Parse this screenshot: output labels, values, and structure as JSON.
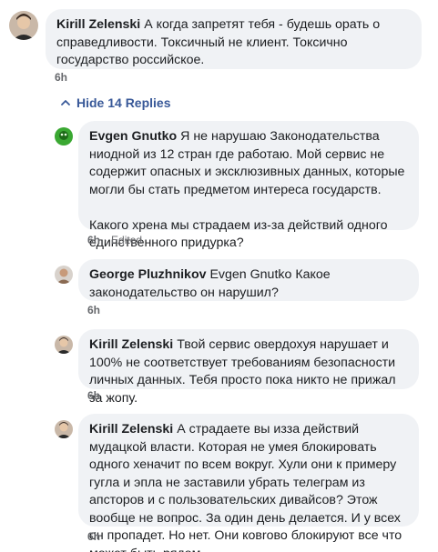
{
  "parent": {
    "author": "Kirill Zelenski",
    "text": "А когда запретят тебя - будешь орать о справедливости. Токсичный не клиент. Токсично государство российское.",
    "time": "6h"
  },
  "replies_toggle": {
    "label": "Hide 14 Replies"
  },
  "replies": [
    {
      "author": "Evgen Gnutko",
      "text": "Я не нарушаю Законодательства ниодной из 12 стран где работаю. Мой сервис не содержит опасных и эксклюзивных данных, которые могли бы стать предметом интереса государств.",
      "text2": "Какого хрена мы страдаем из-за действий одного единственного придурка?",
      "time": "6h",
      "edited": "Edited"
    },
    {
      "author": "George Pluzhnikov",
      "mention": "Evgen Gnutko",
      "text": "Какое законодательство он нарушил?",
      "time": "6h"
    },
    {
      "author": "Kirill Zelenski",
      "text": "Твой сервис овердохуя нарушает и 100% не соответствует требованиям безопасности личных данных. Тебя просто пока никто не прижал за жопу.",
      "time": "6h"
    },
    {
      "author": "Kirill Zelenski",
      "text": "А страдаете вы изза действий мудацкой власти. Которая не умея блокировать одного хеначит по всем вокруг. Хули они к примеру гугла и эпла не заставили убрать телеграм из апсторов и с пользовательских дивайсов? Этож вообще не вопрос. За один день делается. И у всех он пропадет. Но нет. Они ковrово блокируют все что может быть рядом.",
      "time": "6h"
    }
  ]
}
